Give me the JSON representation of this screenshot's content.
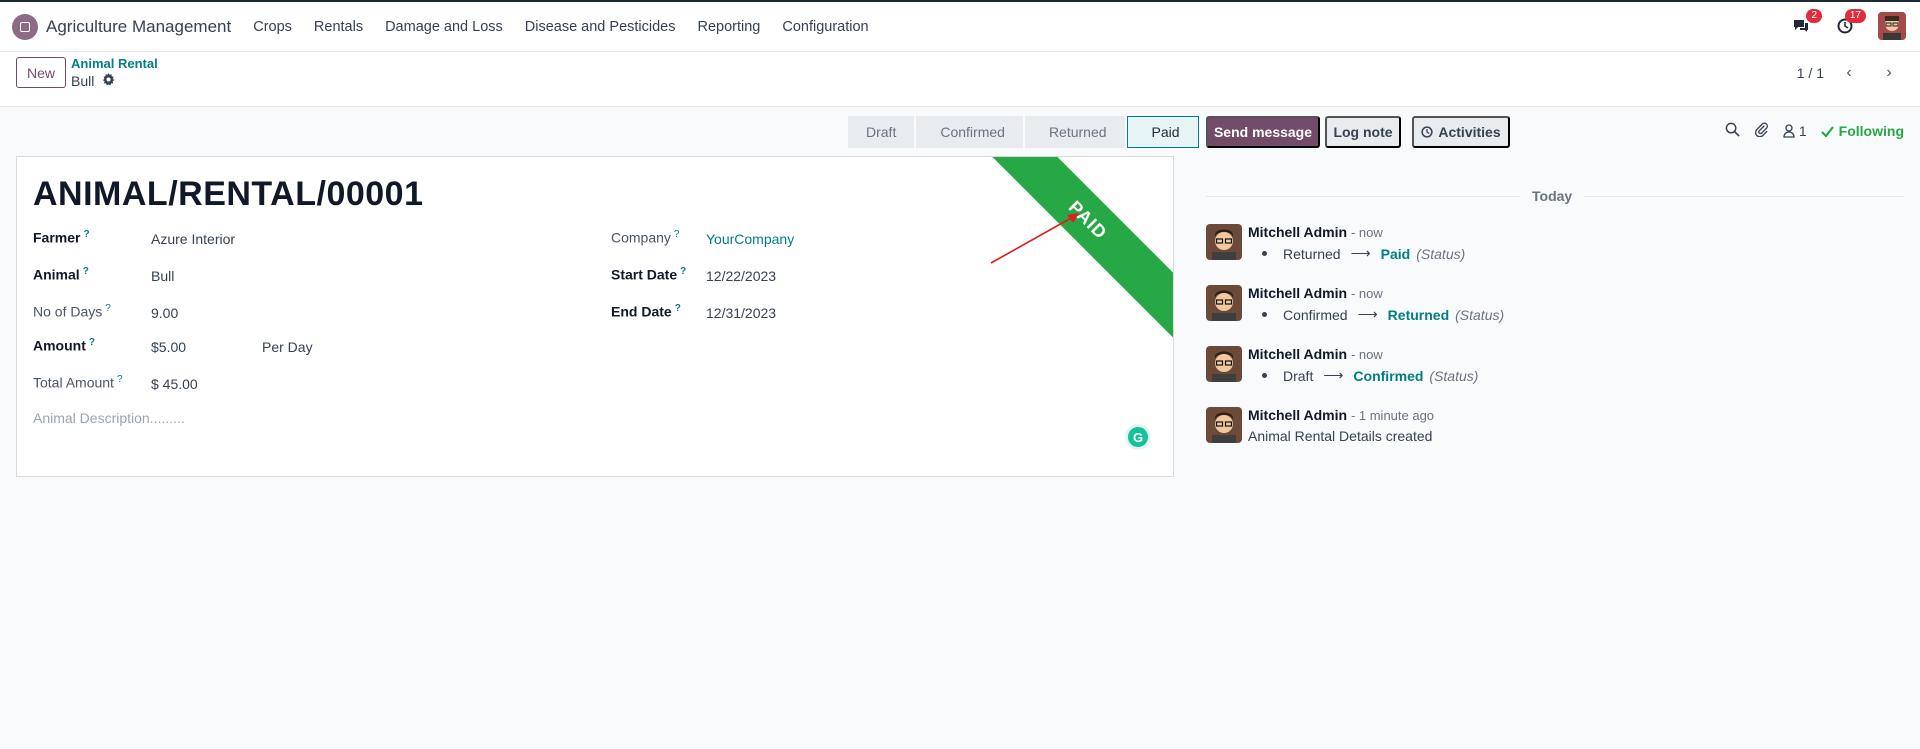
{
  "nav": {
    "app_name": "Agriculture Management",
    "menu": [
      "Crops",
      "Rentals",
      "Damage and Loss",
      "Disease and Pesticides",
      "Reporting",
      "Configuration"
    ],
    "messages_count": "2",
    "activities_count": "17"
  },
  "control": {
    "new_label": "New",
    "breadcrumb_parent": "Animal Rental",
    "breadcrumb_current": "Bull",
    "pager": "1 / 1"
  },
  "status": {
    "stages": [
      "Draft",
      "Confirmed",
      "Returned",
      "Paid"
    ],
    "active": "Paid"
  },
  "form": {
    "title": "ANIMAL/RENTAL/00001",
    "ribbon": "PAID",
    "farmer_label": "Farmer",
    "farmer": "Azure Interior",
    "animal_label": "Animal",
    "animal": "Bull",
    "days_label": "No of Days",
    "days": "9.00",
    "amount_label": "Amount",
    "amount": "$5.00",
    "amount_unit": "Per Day",
    "total_label": "Total Amount",
    "total": "$ 45.00",
    "description_placeholder": "Animal Description.........",
    "company_label": "Company",
    "company": "YourCompany",
    "start_label": "Start Date",
    "start": "12/22/2023",
    "end_label": "End Date",
    "end": "12/31/2023",
    "help_mark": "?"
  },
  "chatter": {
    "send_message": "Send message",
    "log_note": "Log note",
    "activities": "Activities",
    "followers_count": "1",
    "following": "Following",
    "today": "Today",
    "messages": [
      {
        "author": "Mitchell Admin",
        "time": "- now",
        "old": "Returned",
        "new": "Paid",
        "field": "(Status)"
      },
      {
        "author": "Mitchell Admin",
        "time": "- now",
        "old": "Confirmed",
        "new": "Returned",
        "field": "(Status)"
      },
      {
        "author": "Mitchell Admin",
        "time": "- now",
        "old": "Draft",
        "new": "Confirmed",
        "field": "(Status)"
      },
      {
        "author": "Mitchell Admin",
        "time": "- 1 minute ago",
        "text": "Animal Rental Details created"
      }
    ]
  },
  "colors": {
    "primary": "#714b67",
    "link": "#017e84",
    "ribbon": "#28a745",
    "badge": "#e02d3c"
  }
}
